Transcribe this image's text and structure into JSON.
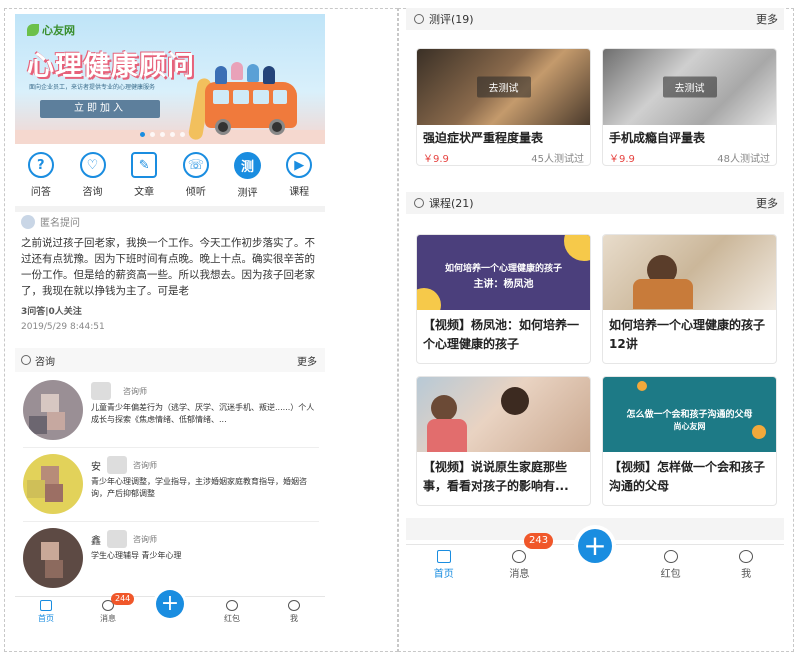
{
  "left": {
    "banner": {
      "logo": "心友网",
      "title": "心理健康顾问",
      "subtitle": "面向企业员工，来访者提供专业的心理健康服务",
      "button": "立即加入"
    },
    "nav_icons": [
      {
        "label": "问答",
        "icon": "question-icon",
        "glyph": "?"
      },
      {
        "label": "咨询",
        "icon": "consult-icon",
        "glyph": "♡"
      },
      {
        "label": "文章",
        "icon": "article-icon",
        "glyph": "✎"
      },
      {
        "label": "倾听",
        "icon": "phone-icon",
        "glyph": "☏"
      },
      {
        "label": "测评",
        "icon": "test-icon",
        "glyph": "测"
      },
      {
        "label": "课程",
        "icon": "play-icon",
        "glyph": "▶"
      }
    ],
    "question": {
      "author": "匿名提问",
      "text": "之前说过孩子回老家，我换一个工作。今天工作初步落实了。不过还有点犹豫。因为下班时间有点晚。晚上十点。确实很辛苦的一份工作。但是给的薪资高一些。所以我想去。因为孩子回老家了，我现在就以挣钱为主了。可是老",
      "stats": "3问答|0人关注",
      "time": "2019/5/29 8:44:51"
    },
    "consult_section": {
      "title": "咨询",
      "more": "更多"
    },
    "consultants": [
      {
        "name": "",
        "role": "咨询师",
        "desc": "儿童青少年偏差行为（逃学、厌学、沉迷手机、叛逆......）个人成长与探索《焦虑情绪、低郁情绪、..."
      },
      {
        "name": "安",
        "role": "咨询师",
        "desc": "青少年心理调整，学业指导，主涉婚姻家庭教育指导，婚姻咨询，产后抑郁调整"
      },
      {
        "name": "鑫",
        "role": "咨询师",
        "desc": "学生心理辅导 青少年心理"
      }
    ],
    "tabbar": {
      "items": [
        {
          "label": "首页",
          "icon": "home-icon"
        },
        {
          "label": "消息",
          "icon": "bell-icon"
        },
        {
          "label": "红包",
          "icon": "redpacket-icon"
        },
        {
          "label": "我",
          "icon": "user-icon"
        }
      ],
      "badge": "244",
      "plus": "+"
    }
  },
  "right": {
    "test_section": {
      "title": "测评(19)",
      "more": "更多"
    },
    "tests": [
      {
        "title": "强迫症状严重程度量表",
        "price": "￥9.9",
        "count": "45人测试过",
        "action": "去测试"
      },
      {
        "title": "手机成瘾自评量表",
        "price": "￥9.9",
        "count": "48人测试过",
        "action": "去测试"
      }
    ],
    "course_section": {
      "title": "课程(21)",
      "more": "更多"
    },
    "courses": [
      {
        "title": "【视频】杨凤池：如何培养一个心理健康的孩子",
        "image_text": "如何培养一个心理健康的孩子",
        "image_sub": "主讲：杨凤池"
      },
      {
        "title": "如何培养一个心理健康的孩子12讲",
        "image_text": "",
        "image_sub": ""
      },
      {
        "title": "【视频】说说原生家庭那些事，看看对孩子的影响有...",
        "image_text": "",
        "image_sub": ""
      },
      {
        "title": "【视频】怎样做一个会和孩子沟通的父母",
        "image_text": "怎么做一个会和孩子沟通的父母",
        "image_sub": "尚心友网"
      }
    ],
    "tabbar": {
      "items": [
        {
          "label": "首页",
          "icon": "home-icon"
        },
        {
          "label": "消息",
          "icon": "bell-icon"
        },
        {
          "label": "红包",
          "icon": "redpacket-icon"
        },
        {
          "label": "我",
          "icon": "user-icon"
        }
      ],
      "badge": "243",
      "plus": "+"
    }
  },
  "colors": {
    "accent": "#1a8de0",
    "price": "#e64340",
    "badge": "#f0572a"
  }
}
